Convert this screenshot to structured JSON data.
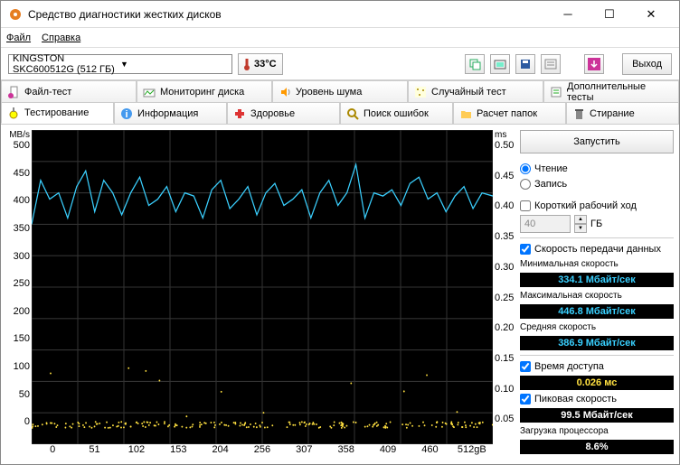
{
  "window": {
    "title": "Средство диагностики жестких дисков"
  },
  "menu": {
    "file": "Файл",
    "help": "Справка"
  },
  "toolbar": {
    "device": "KINGSTON SKC600512G (512 ГБ)",
    "temp": "33°C",
    "exit": "Выход"
  },
  "tabs": {
    "file_test": "Файл-тест",
    "monitoring": "Мониторинг диска",
    "noise": "Уровень шума",
    "random": "Случайный тест",
    "extra": "Дополнительные тесты",
    "testing": "Тестирование",
    "info": "Информация",
    "health": "Здоровье",
    "errors": "Поиск ошибок",
    "folders": "Расчет папок",
    "erase": "Стирание"
  },
  "side": {
    "run": "Запустить",
    "read": "Чтение",
    "write": "Запись",
    "short": "Короткий рабочий ход",
    "size": "40",
    "gb": "ГБ",
    "transfer": "Скорость передачи данных",
    "min_l": "Минимальная скорость",
    "min_v": "334.1 Мбайт/сек",
    "max_l": "Максимальная скорость",
    "max_v": "446.8 Мбайт/сек",
    "avg_l": "Средняя скорость",
    "avg_v": "386.9 Мбайт/сек",
    "access": "Время доступа",
    "access_v": "0.026 мс",
    "peak": "Пиковая скорость",
    "peak_v": "99.5 Мбайт/сек",
    "cpu_l": "Загрузка процессора",
    "cpu_v": "8.6%"
  },
  "chart_data": {
    "type": "line",
    "ylabel": "MB/s",
    "y2label": "ms",
    "xlabel_end": "512gB",
    "ylim": [
      0,
      500
    ],
    "y2lim": [
      0,
      0.5
    ],
    "xrange": [
      0,
      512
    ],
    "yticks": [
      0,
      50,
      100,
      150,
      200,
      250,
      300,
      350,
      400,
      450,
      500
    ],
    "y2ticks": [
      0.05,
      0.1,
      0.15,
      0.2,
      0.25,
      0.3,
      0.35,
      0.4,
      0.45,
      0.5
    ],
    "xticks": [
      0,
      51,
      102,
      153,
      204,
      256,
      307,
      358,
      409,
      460,
      "512gB"
    ],
    "series": [
      {
        "name": "transfer_rate",
        "color": "#3ad0ff",
        "unit": "MB/s",
        "x": [
          0,
          10,
          20,
          30,
          40,
          50,
          60,
          70,
          80,
          90,
          100,
          110,
          120,
          130,
          140,
          150,
          160,
          170,
          180,
          190,
          200,
          210,
          220,
          230,
          240,
          250,
          260,
          270,
          280,
          290,
          300,
          310,
          320,
          330,
          340,
          350,
          360,
          370,
          380,
          390,
          400,
          410,
          420,
          430,
          440,
          450,
          460,
          470,
          480,
          490,
          500,
          512
        ],
        "values": [
          350,
          420,
          390,
          400,
          360,
          410,
          435,
          370,
          420,
          400,
          365,
          400,
          425,
          380,
          390,
          410,
          370,
          400,
          395,
          360,
          405,
          420,
          375,
          390,
          410,
          365,
          400,
          415,
          380,
          390,
          405,
          360,
          400,
          420,
          380,
          400,
          445,
          360,
          400,
          395,
          405,
          380,
          415,
          425,
          390,
          400,
          370,
          395,
          410,
          375,
          400,
          395
        ]
      },
      {
        "name": "access_time",
        "color": "#ffe040",
        "unit": "ms",
        "typical": 0.026,
        "baseline": 0.026
      }
    ]
  }
}
